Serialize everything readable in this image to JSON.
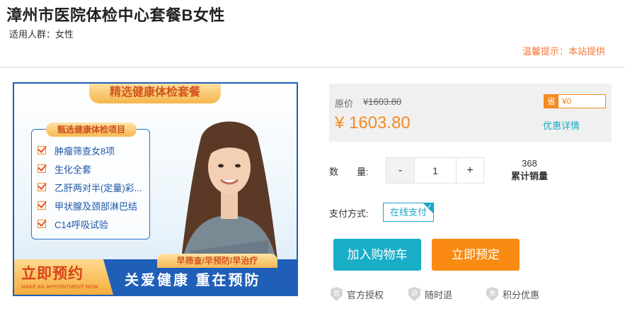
{
  "header": {
    "title": "漳州市医院体检中心套餐B女性",
    "audience": "适用人群：女性",
    "tip": "温馨提示：本站提供"
  },
  "banner": {
    "top_ribbon": "精选健康体检套餐",
    "checklist_title": "甄选健康体检项目",
    "items": [
      {
        "label": "肿瘤筛查女8项"
      },
      {
        "label": "生化全套"
      },
      {
        "label": "乙肝两对半(定量)彩..."
      },
      {
        "label": "甲状腺及颈部淋巴结"
      },
      {
        "label": "C14呼吸试验"
      }
    ],
    "cta": "立即预约",
    "cta_sub": "MAKE AN APPOINTMENT NOW",
    "slogan_ribbon": "早筛查/早预防/早治疗",
    "slogan": "关爱健康  重在预防"
  },
  "price": {
    "original_label": "原价",
    "original_value": "¥1603.80",
    "current_value": "¥ 1603.80",
    "save_tag": "省",
    "save_amount": "¥0",
    "discount_link": "优惠详情"
  },
  "quantity": {
    "label": "数　　量:",
    "minus": "-",
    "value": "1",
    "plus": "+",
    "sales_count": "368",
    "sales_label": "累计销量"
  },
  "payment": {
    "label": "支付方式:",
    "option": "在线支付"
  },
  "actions": {
    "add_to_cart": "加入购物车",
    "book_now": "立即预定"
  },
  "guarantees": [
    {
      "icon_char": "官",
      "label": "官方授权",
      "icon": "shield-icon"
    },
    {
      "icon_char": "退",
      "label": "随时退",
      "icon": "shield-icon"
    },
    {
      "icon_char": "惠",
      "label": "积分优惠",
      "icon": "shield-icon"
    }
  ],
  "colors": {
    "accent_orange": "#f98b12",
    "accent_teal": "#19aec8",
    "banner_blue": "#1f5fb8"
  }
}
